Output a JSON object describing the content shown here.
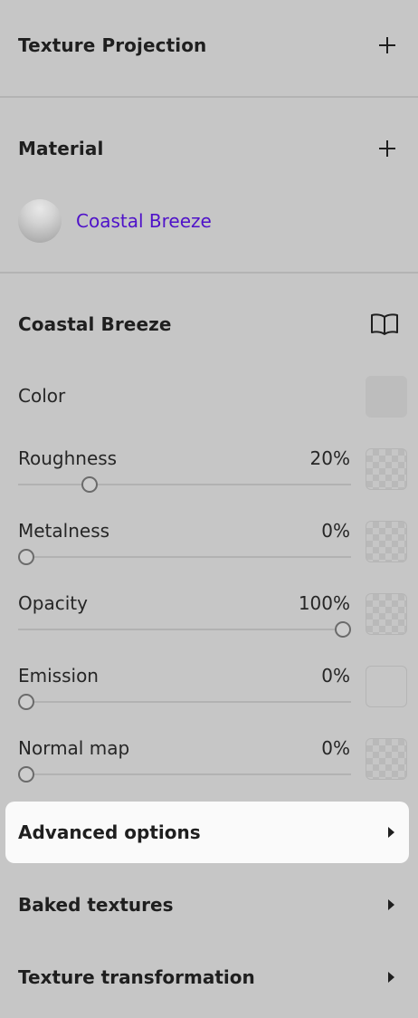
{
  "sections": {
    "texture_projection": {
      "title": "Texture Projection",
      "action_icon": "plus-icon"
    },
    "material": {
      "title": "Material",
      "action_icon": "plus-icon",
      "item_name": "Coastal Breeze"
    },
    "material_editor": {
      "title": "Coastal Breeze",
      "action_icon": "book-icon"
    }
  },
  "properties": {
    "color": {
      "label": "Color",
      "swatch": "#bdbdbd"
    },
    "roughness": {
      "label": "Roughness",
      "value": "20%",
      "level": 0.2
    },
    "metalness": {
      "label": "Metalness",
      "value": "0%",
      "level": 0.0
    },
    "opacity": {
      "label": "Opacity",
      "value": "100%",
      "level": 1.0
    },
    "emission": {
      "label": "Emission",
      "value": "0%",
      "level": 0.0
    },
    "normal_map": {
      "label": "Normal map",
      "value": "0%",
      "level": 0.0
    }
  },
  "collapsibles": {
    "advanced": {
      "title": "Advanced options"
    },
    "baked": {
      "title": "Baked textures"
    },
    "transformation": {
      "title": "Texture transformation"
    }
  },
  "colors": {
    "panel_bg": "#c6c6c6",
    "accent_link": "#4f12c9",
    "active_row_bg": "#fafafa"
  }
}
